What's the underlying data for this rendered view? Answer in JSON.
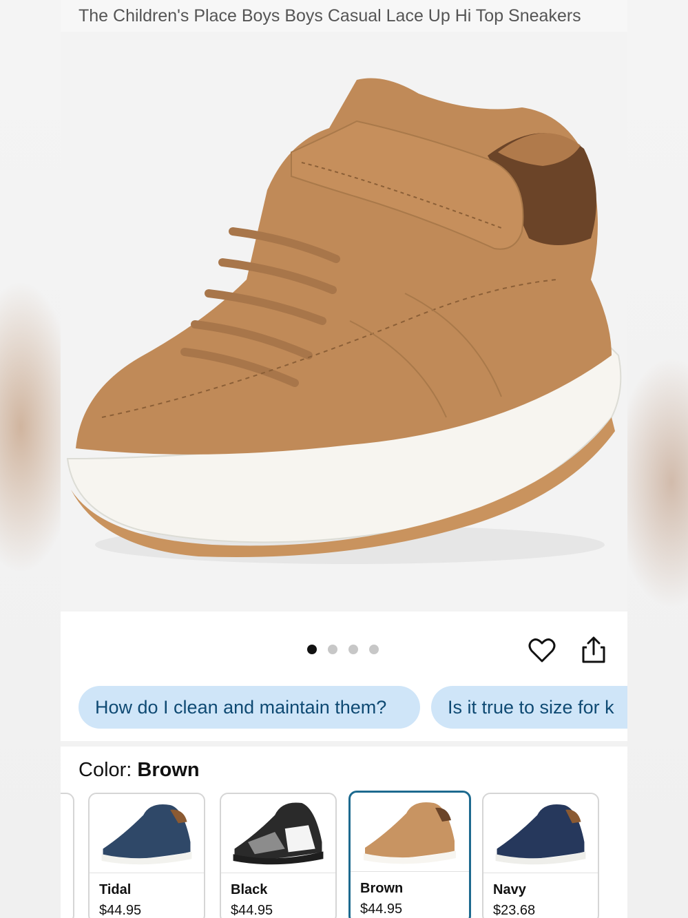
{
  "product": {
    "title": "The Children's Place Boys Boys Casual Lace Up Hi Top Sneakers"
  },
  "gallery": {
    "image_count": 4,
    "active_index": 0
  },
  "actions": {
    "favorite_icon": "heart-icon",
    "share_icon": "share-icon"
  },
  "questions": [
    {
      "label": "How do I clean and maintain them?"
    },
    {
      "label": "Is it true to size for k"
    }
  ],
  "color": {
    "label": "Color: ",
    "selected": "Brown"
  },
  "swatches": [
    {
      "name": "Tidal",
      "price": "$44.95"
    },
    {
      "name": "Black",
      "price": "$44.95"
    },
    {
      "name": "Brown",
      "price": "$44.95"
    },
    {
      "name": "Navy",
      "price": "$23.68"
    }
  ],
  "colors": {
    "chip_bg": "#cfe5f8",
    "chip_text": "#0f4a73",
    "selected_border": "#1d6a8f"
  }
}
